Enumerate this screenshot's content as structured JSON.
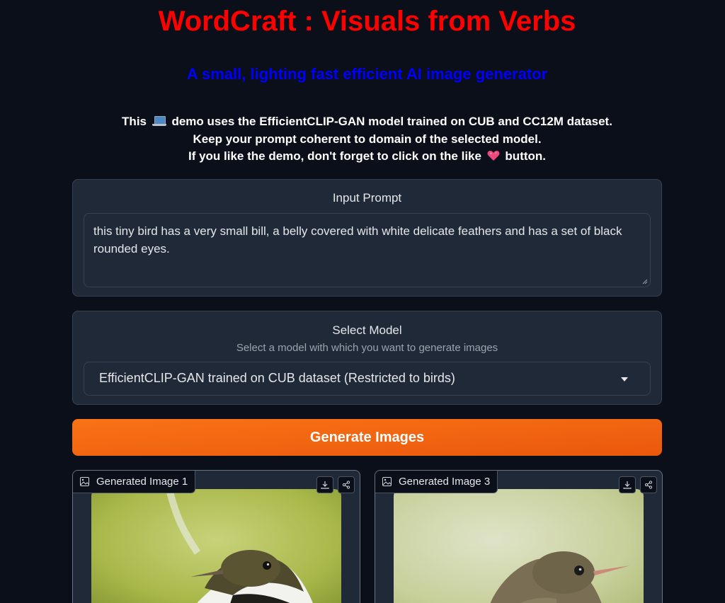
{
  "header": {
    "title": "WordCraft : Visuals from Verbs",
    "subtitle": "A small, lighting fast efficient AI image generator",
    "desc_line1_a": "This",
    "desc_line1_b": "demo uses the EfficientCLIP-GAN model trained on CUB and CC12M dataset.",
    "desc_line2": "Keep your prompt coherent to domain of the selected model.",
    "desc_line3_a": "If you like the demo, don't forget to click on the like",
    "desc_line3_b": "button."
  },
  "prompt": {
    "label": "Input Prompt",
    "value": "this tiny bird has a very small bill, a belly covered with white delicate feathers and has a set of black rounded eyes."
  },
  "model": {
    "label": "Select Model",
    "info": "Select a model with which you want to generate images",
    "selected": "EfficientCLIP-GAN trained on CUB dataset (Restricted to birds)"
  },
  "generate_button": "Generate Images",
  "gallery": [
    {
      "label": "Generated Image 1"
    },
    {
      "label": "Generated Image 3"
    }
  ],
  "icons": {
    "desc_emoji_1": "laptop-icon",
    "desc_emoji_2": "sparkling-heart-icon",
    "gallery_label": "image-icon",
    "download": "download-icon",
    "share": "share-icon",
    "dropdown": "chevron-down-icon"
  },
  "colors": {
    "background": "#0b0f19",
    "title": "#ff0000",
    "subtitle": "#0000ff",
    "panel": "#1f2937",
    "button": "#f97316"
  }
}
